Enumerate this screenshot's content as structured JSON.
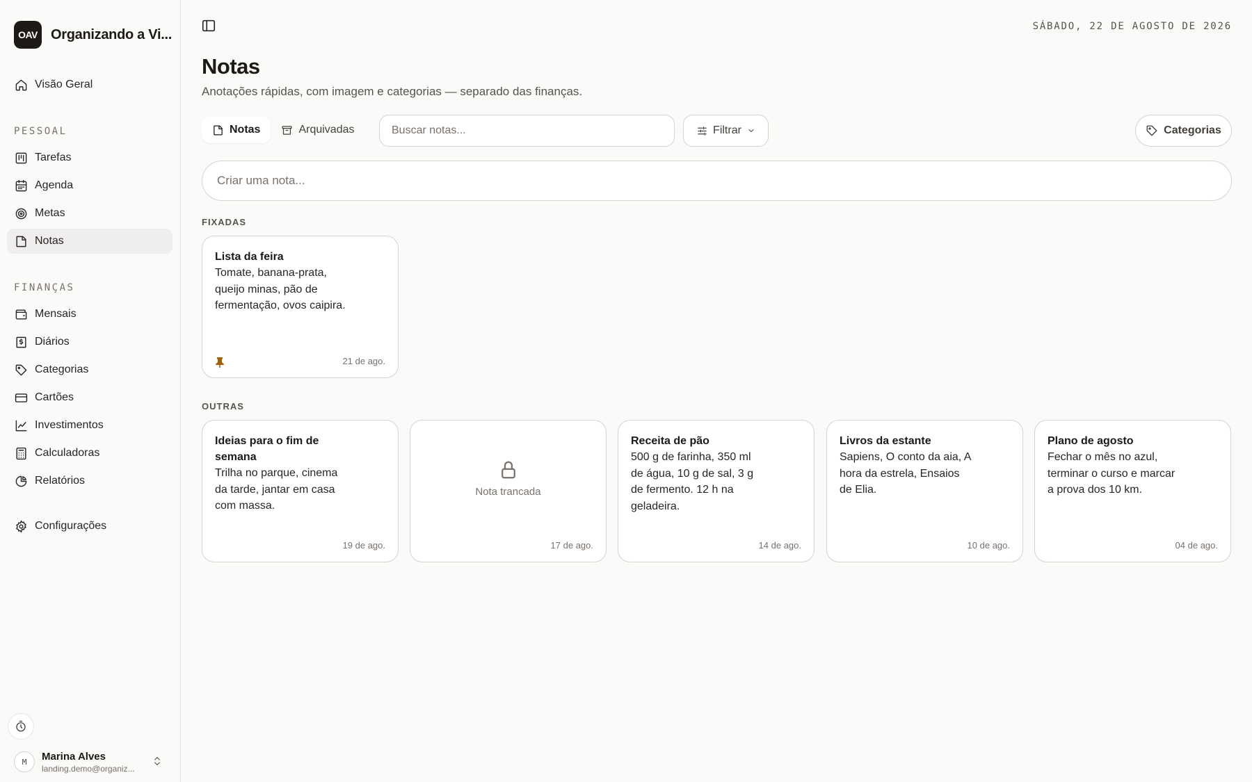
{
  "app": {
    "logo": "OAV",
    "name": "Organizando a Vi..."
  },
  "sidebar": {
    "top_item": {
      "label": "Visão Geral",
      "icon": "home-icon"
    },
    "sections": [
      {
        "label": "PESSOAL",
        "items": [
          {
            "label": "Tarefas",
            "icon": "kanban-icon"
          },
          {
            "label": "Agenda",
            "icon": "calendar-icon"
          },
          {
            "label": "Metas",
            "icon": "target-icon"
          },
          {
            "label": "Notas",
            "icon": "note-icon",
            "active": true
          }
        ]
      },
      {
        "label": "FINANÇAS",
        "items": [
          {
            "label": "Mensais",
            "icon": "wallet-icon"
          },
          {
            "label": "Diários",
            "icon": "receipt-icon"
          },
          {
            "label": "Categorias",
            "icon": "tag-icon"
          },
          {
            "label": "Cartões",
            "icon": "credit-card-icon"
          },
          {
            "label": "Investimentos",
            "icon": "line-chart-icon"
          },
          {
            "label": "Calculadoras",
            "icon": "calculator-icon"
          },
          {
            "label": "Relatórios",
            "icon": "pie-chart-icon"
          }
        ]
      }
    ],
    "settings": {
      "label": "Configurações",
      "icon": "gear-icon"
    },
    "user": {
      "initial": "M",
      "name": "Marina Alves",
      "email": "landing.demo@organiz..."
    }
  },
  "header": {
    "date": "SÁBADO, 22 DE AGOSTO DE 2026",
    "title": "Notas",
    "subtitle": "Anotações rápidas, com imagem e categorias — separado das finanças."
  },
  "toolbar": {
    "tabs": [
      {
        "label": "Notas",
        "icon": "note-icon",
        "active": true
      },
      {
        "label": "Arquivadas",
        "icon": "archive-icon",
        "active": false
      }
    ],
    "search_placeholder": "Buscar notas...",
    "filter_label": "Filtrar",
    "categories_label": "Categorias"
  },
  "create_placeholder": "Criar uma nota...",
  "pinned": {
    "label": "FIXADAS",
    "notes": [
      {
        "title": "Lista da feira",
        "body": "Tomate, banana-prata, queijo minas, pão de fermentação, ovos caipira.",
        "date": "21 de ago.",
        "pinned": true
      }
    ]
  },
  "others": {
    "label": "OUTRAS",
    "notes": [
      {
        "title": "Ideias para o fim de semana",
        "body": "Trilha no parque, cinema da tarde, jantar em casa com massa.",
        "date": "19 de ago."
      },
      {
        "locked": true,
        "locked_label": "Nota trancada",
        "date": "17 de ago."
      },
      {
        "title": "Receita de pão",
        "body": "500 g de farinha, 350 ml de água, 10 g de sal, 3 g de fermento. 12 h na geladeira.",
        "date": "14 de ago."
      },
      {
        "title": "Livros da estante",
        "body": "Sapiens, O conto da aia, A hora da estrela, Ensaios de Elia.",
        "date": "10 de ago."
      },
      {
        "title": "Plano de agosto",
        "body": "Fechar o mês no azul, terminar o curso e marcar a prova dos 10 km.",
        "date": "04 de ago."
      }
    ]
  },
  "colors": {
    "accent": "#1c1917",
    "background": "#fafaf9",
    "border": "#d6d3d1",
    "pin": "#a16207"
  }
}
